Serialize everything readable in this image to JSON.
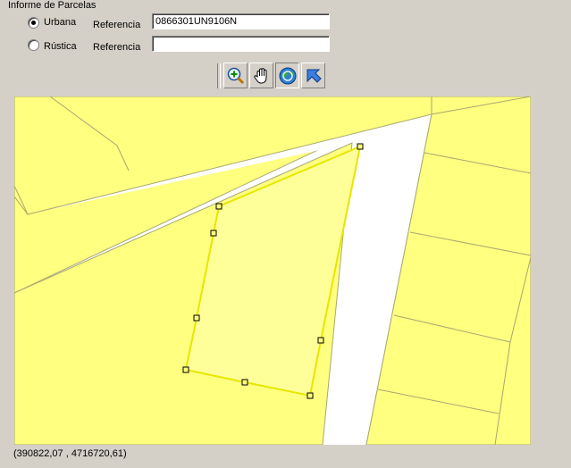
{
  "panel": {
    "title": "Informe de Parcelas"
  },
  "urbana": {
    "option_label": "Urbana",
    "ref_label": "Referencia",
    "ref_value": "0866301UN9106N",
    "selected": true
  },
  "rustica": {
    "option_label": "Rústica",
    "ref_label": "Referencia",
    "ref_value": "",
    "selected": false
  },
  "toolbar": {
    "tools": [
      {
        "icon": "zoom-in-icon"
      },
      {
        "icon": "pan-hand-icon"
      },
      {
        "icon": "zoom-extent-globe-icon"
      },
      {
        "icon": "select-arrow-icon"
      }
    ]
  },
  "map": {
    "colors": {
      "parcel_fill": "#ffff80",
      "street": "#ffffff",
      "selected_fill": "#ffff99",
      "selected_edge": "#e6e600",
      "parcel_border": "#a8a870"
    }
  },
  "status": {
    "coordinates": "(390822,07 , 4716720,61)"
  }
}
